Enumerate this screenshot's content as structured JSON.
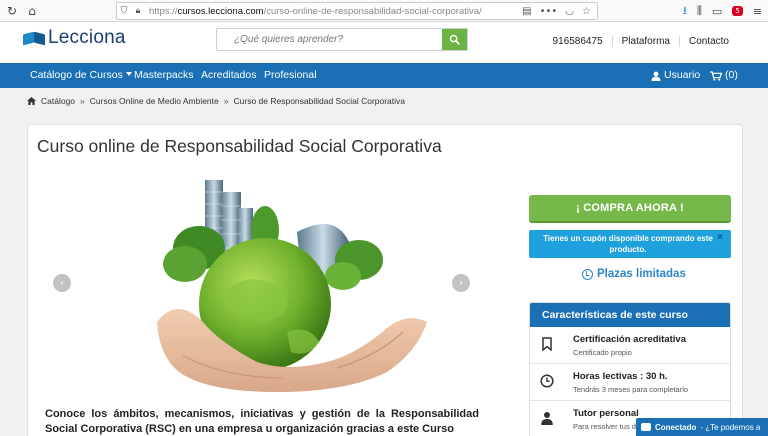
{
  "browser": {
    "url_prefix": "https://",
    "url_host": "cursos.lecciona.com",
    "url_path": "/curso-online-de-responsabilidad-social-corporativa/",
    "ext_badge": "5"
  },
  "header": {
    "logo_text": "Lecciona",
    "search_placeholder": "¿Qué quieres aprender?",
    "phone": "916586475",
    "platform_label": "Plataforma",
    "contact_label": "Contacto"
  },
  "nav": {
    "catalog": "Catálogo de Cursos",
    "masterpacks": "Masterpacks",
    "accredited": "Acreditados",
    "professional": "Profesional",
    "user": "Usuario",
    "cart": "(0)"
  },
  "breadcrumb": {
    "home": "Catálogo",
    "category": "Cursos Online de Medio Ambiente",
    "current": "Curso de Responsabilidad Social Corporativa",
    "separator": "»"
  },
  "course": {
    "title": "Curso online de Responsabilidad Social Corporativa",
    "description": "Conoce los ámbitos, mecanismos, iniciativas y gestión de la Responsabilidad Social Corporativa (RSC) en una empresa u organización gracias a este Curso"
  },
  "sidebar": {
    "buy_label": "¡ COMPRA AHORA !",
    "coupon_text": "Tienes un cupón disponible comprando este producto.",
    "coupon_close": "×",
    "places_label": "Plazas limitadas",
    "features_title": "Características de este curso",
    "features": [
      {
        "icon": "bookmark-icon",
        "title": "Certificación acreditativa",
        "subtitle": "Certificado propio"
      },
      {
        "icon": "clock-icon",
        "title": "Horas lectivas : 30 h.",
        "subtitle": "Tendrás 3 meses para completarlo"
      },
      {
        "icon": "user-icon",
        "title": "Tutor personal",
        "subtitle": "Para resolver tus d"
      }
    ]
  },
  "chat": {
    "status": "Conectado",
    "message": "- ¿Te podemos a"
  },
  "colors": {
    "brand_blue": "#1a6fb5",
    "buy_green": "#76b84a",
    "coupon_blue": "#1ea1dc",
    "search_green": "#6bb342"
  }
}
